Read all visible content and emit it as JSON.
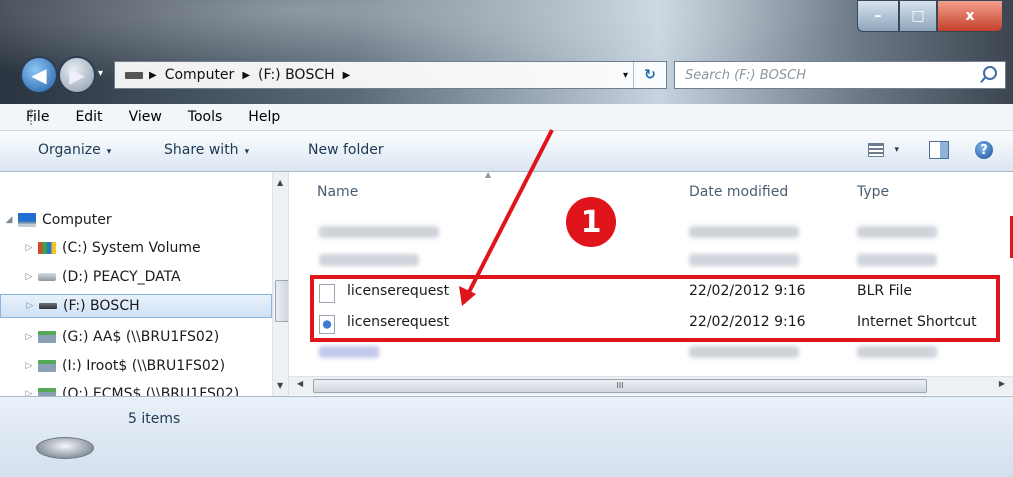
{
  "window": {
    "minimize_glyph": "–",
    "maximize_glyph": "□",
    "close_glyph": "x"
  },
  "nav": {
    "back_glyph": "◀",
    "forward_glyph": "▶",
    "history_glyph": "▾",
    "breadcrumb": [
      "Computer",
      "(F:) BOSCH"
    ],
    "breadcrumb_sep": "▶",
    "address_dropdown": "▾",
    "refresh_glyph": "↻",
    "search_placeholder": "Search (F:) BOSCH"
  },
  "menu": {
    "items": [
      "File",
      "Edit",
      "View",
      "Tools",
      "Help"
    ]
  },
  "toolbar": {
    "organize": "Organize",
    "share_with": "Share with",
    "new_folder": "New folder",
    "caret": "▾",
    "help_glyph": "?"
  },
  "navpane": {
    "items": [
      {
        "label": "Computer",
        "icon": "computer-icon",
        "expanded": true
      },
      {
        "label": "(C:) System Volume",
        "icon": "windows-drive-icon"
      },
      {
        "label": "(D:) PEACY_DATA",
        "icon": "drive-icon"
      },
      {
        "label": "(F:) BOSCH",
        "icon": "usb-drive-icon",
        "selected": true
      },
      {
        "label": "(G:) AA$ (\\\\BRU1FS02)",
        "icon": "network-drive-icon"
      },
      {
        "label": "(I:) Iroot$ (\\\\BRU1FS02)",
        "icon": "network-drive-icon"
      },
      {
        "label": "(O:) ECMS$ (\\\\BRU1FS02)",
        "icon": "network-drive-icon"
      }
    ],
    "expand_glyph": "▷",
    "collapse_glyph": "◢"
  },
  "columns": {
    "name": "Name",
    "date_modified": "Date modified",
    "type": "Type"
  },
  "files": [
    {
      "name": "licenserequest",
      "date_modified": "22/02/2012 9:16",
      "type": "BLR File",
      "icon": "file-icon"
    },
    {
      "name": "licenserequest",
      "date_modified": "22/02/2012 9:16",
      "type": "Internet Shortcut",
      "icon": "internet-shortcut-icon"
    }
  ],
  "hscroll": {
    "thumb_glyph": "III"
  },
  "status": {
    "item_count": "5 items"
  },
  "annotation": {
    "step_number": "1",
    "color": "#e0141b"
  }
}
